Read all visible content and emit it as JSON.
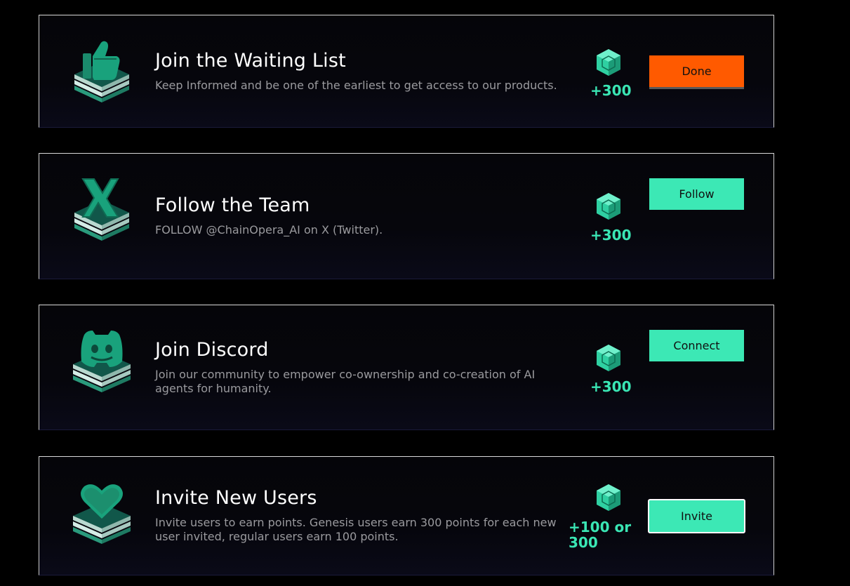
{
  "tasks": [
    {
      "title": "Join the Waiting List",
      "description": "Keep Informed and be one of the earliest to get access to our products.",
      "points": "+300",
      "button": "Done",
      "icon": "thumbs-up-icon"
    },
    {
      "title": "Follow the Team",
      "description": "FOLLOW @ChainOpera_AI on X (Twitter).",
      "points": "+300",
      "button": "Follow",
      "icon": "x-logo-icon"
    },
    {
      "title": "Join Discord",
      "description": "Join our community to empower co-ownership and co-creation of AI agents for humanity.",
      "points": "+300",
      "button": "Connect",
      "icon": "discord-icon"
    },
    {
      "title": "Invite New Users",
      "description": "Invite users to earn points. Genesis users earn 300 points for each new user invited, regular users earn 100 points.",
      "points": "+100 or 300",
      "button": "Invite",
      "icon": "heart-icon"
    }
  ],
  "colors": {
    "accent_green": "#3ce8b5",
    "done_orange": "#ff5a00",
    "background": "#000000"
  }
}
